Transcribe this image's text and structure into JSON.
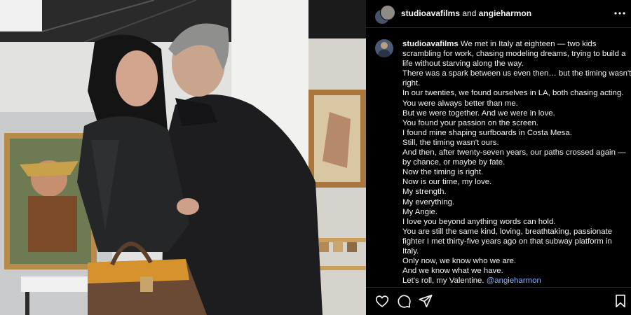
{
  "post": {
    "header": {
      "author": "studioavafilms",
      "joiner": " and ",
      "collaborator": "angieharmon"
    },
    "caption": {
      "username": "studioavafilms",
      "first_line_rest": " We met in Italy at eighteen — two kids",
      "lines": [
        "scrambling for work, chasing modeling dreams, trying to build a",
        "life without starving along the way.",
        "There was a spark between us even then… but the timing wasn't",
        "right.",
        "In our twenties, we found ourselves in LA, both chasing acting.",
        "You were always better than me.",
        "But we were together. And we were in love.",
        "You found your passion on the screen.",
        "I found mine shaping surfboards in Costa Mesa.",
        "Still, the timing wasn't ours.",
        "And then, after twenty-seven years, our paths crossed again —",
        "by chance, or maybe by fate.",
        "Now the timing is right.",
        "Now is our time, my love.",
        "My strength.",
        "My everything.",
        "My Angie.",
        "I love you beyond anything words can hold.",
        "You are still the same kind, loving, breathtaking, passionate",
        "fighter I met thirty-five years ago on that subway platform in",
        "Italy.",
        "Only now, we know who we are.",
        "And we know what we have."
      ],
      "last_line_text": "Let's roll, my Valentine. ",
      "mention": "@angieharmon"
    },
    "actions": [
      "heart-icon",
      "comment-icon",
      "share-icon",
      "bookmark-icon"
    ],
    "colors": {
      "background": "#000000",
      "text": "#f5f5f5",
      "mention": "#8fb7ff"
    }
  }
}
